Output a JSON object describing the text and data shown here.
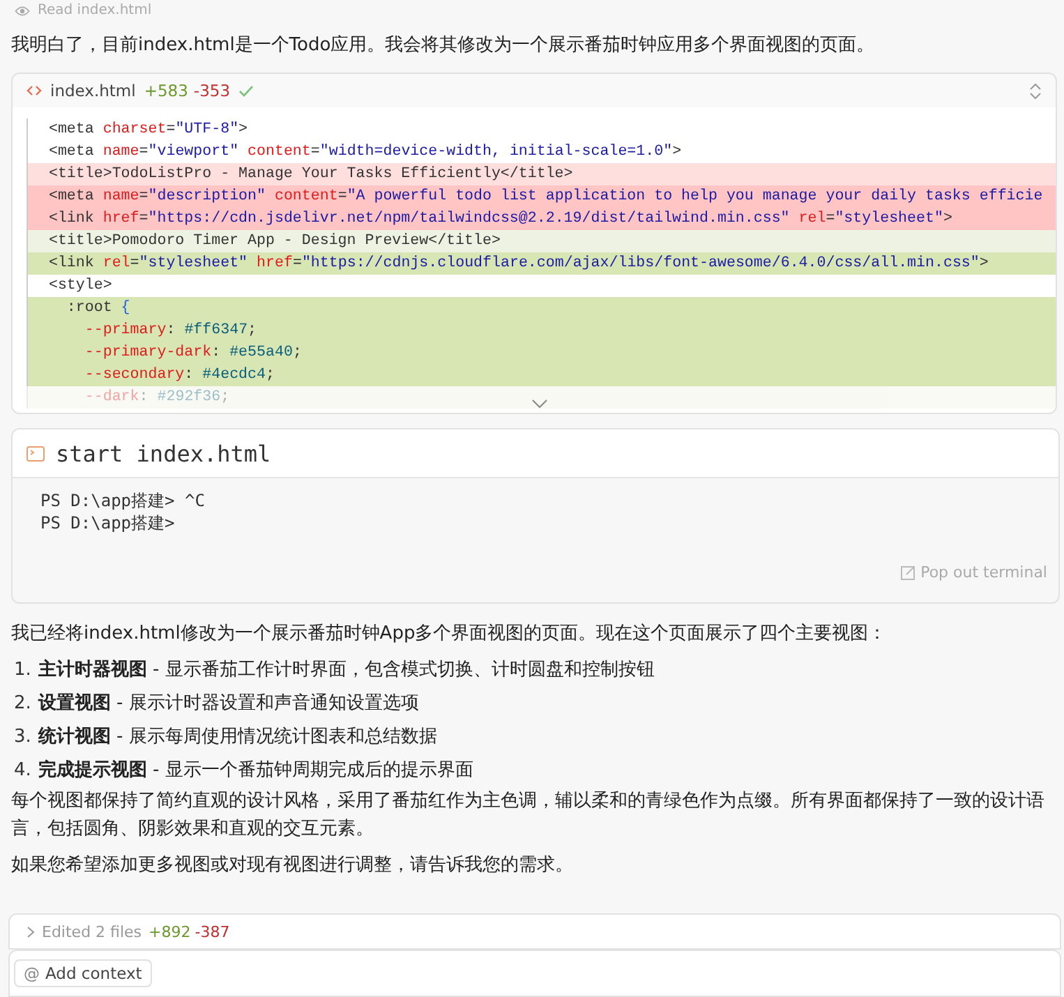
{
  "tool_step": {
    "label": "Read index.html"
  },
  "intro": "我明白了，目前index.html是一个Todo应用。我会将其修改为一个展示番茄时钟应用多个界面视图的页面。",
  "code_block": {
    "filename": "index.html",
    "added": "+583",
    "removed": "-353",
    "saved": true,
    "lines": [
      {
        "kind": "context",
        "text": "  <meta charset=\"UTF-8\">"
      },
      {
        "kind": "context",
        "text": "  <meta name=\"viewport\" content=\"width=device-width, initial-scale=1.0\">"
      },
      {
        "kind": "removed",
        "text": "  <title>TodoListPro - Manage Your Tasks Efficiently</title>"
      },
      {
        "kind": "removed_full",
        "text": "  <meta name=\"description\" content=\"A powerful todo list application to help you manage your daily tasks efficie"
      },
      {
        "kind": "removed_full",
        "text": "  <link href=\"https://cdn.jsdelivr.net/npm/tailwindcss@2.2.19/dist/tailwind.min.css\" rel=\"stylesheet\">"
      },
      {
        "kind": "added",
        "text": "  <title>Pomodoro Timer App - Design Preview</title>"
      },
      {
        "kind": "added_full",
        "text": "  <link rel=\"stylesheet\" href=\"https://cdnjs.cloudflare.com/ajax/libs/font-awesome/6.4.0/css/all.min.css\">"
      },
      {
        "kind": "context",
        "text": "  <style>"
      },
      {
        "kind": "added_full",
        "text": "    :root {"
      },
      {
        "kind": "added_full",
        "text": "      --primary: #ff6347;"
      },
      {
        "kind": "added_full",
        "text": "      --primary-dark: #e55a40;"
      },
      {
        "kind": "added_full",
        "text": "      --secondary: #4ecdc4;"
      },
      {
        "kind": "added",
        "faded": true,
        "text": "      --dark: #292f36;"
      }
    ]
  },
  "terminal": {
    "command": "start index.html",
    "output": [
      "PS D:\\app搭建> ^C",
      "PS D:\\app搭建>"
    ],
    "popout": "Pop out terminal"
  },
  "summary": "我已经将index.html修改为一个展示番茄时钟App多个界面视图的页面。现在这个页面展示了四个主要视图：",
  "views": [
    {
      "number": "1.",
      "text": "**主计时器视图** - 显示番茄工作计时界面，包含模式切换、计时圆盘和控制按钮"
    },
    {
      "number": "2.",
      "text": "**设置视图** - 展示计时器设置和声音通知设置选项"
    },
    {
      "number": "3.",
      "text": "**统计视图** - 展示每周使用情况统计图表和总结数据"
    },
    {
      "number": "4.",
      "text": "**完成提示视图** - 显示一个番茄钟周期完成后的提示界面"
    }
  ],
  "paragraphs": [
    "每个视图都保持了简约直观的设计风格，采用了番茄红作为主色调，辅以柔和的青绿色作为点缀。所有界面都保持了一致的设计语言，包括圆角、阴影效果和直观的交互元素。",
    "如果您希望添加更多视图或对现有视图进行调整，请告诉我您的需求。"
  ],
  "edited": {
    "label": "Edited 2 files",
    "added": "+892",
    "removed": "-387",
    "expanded": false
  },
  "composer": {
    "at_symbol": "@",
    "context_button": "Add context"
  }
}
